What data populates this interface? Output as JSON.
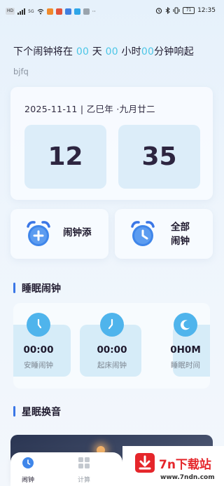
{
  "status_bar": {
    "left_chips": [
      "HD",
      "5G"
    ],
    "battery": "71",
    "time": "12:35"
  },
  "header": {
    "prefix": "下个闹钟将在",
    "days": "00",
    "days_unit": "天",
    "hours": "00",
    "hours_unit": "小时",
    "minutes": "00",
    "minutes_unit": "分钟响起",
    "username": "bjfq"
  },
  "date_card": {
    "date_text": "2025-11-11 | 乙巳年 ·九月廿二",
    "hour": "12",
    "minute": "35"
  },
  "actions": {
    "add_label": "闹钟添",
    "all_label_line1": "全部",
    "all_label_line2": "闹钟"
  },
  "sleep_section": {
    "title": "睡眠闹钟",
    "items": [
      {
        "value": "00:00",
        "label": "安睡闹钟",
        "icon": "clock-icon"
      },
      {
        "value": "00:00",
        "label": "起床闹钟",
        "icon": "clock-icon"
      },
      {
        "value": "0H0M",
        "label": "睡眠时间",
        "icon": "moon-icon"
      }
    ]
  },
  "star_section": {
    "title": "星眠换音"
  },
  "bottom_nav": {
    "items": [
      {
        "label": "闹钟",
        "icon": "alarm-icon",
        "active": true
      },
      {
        "label": "计算",
        "icon": "calculator-icon",
        "active": false
      }
    ]
  },
  "watermark": {
    "title": "7n下载站",
    "url": "www.7ndn.com"
  },
  "colors": {
    "accent_cyan": "#4cc6e6",
    "accent_blue": "#3a76e6",
    "icon_blue": "#4fb4ec",
    "watermark_red": "#e5262b"
  }
}
